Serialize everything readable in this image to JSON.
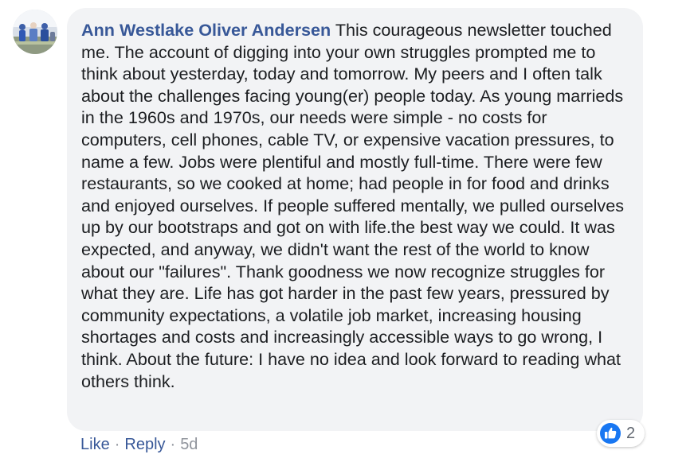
{
  "comment": {
    "author": "Ann Westlake Oliver Andersen",
    "text": "This courageous newsletter touched me. The account of digging into your own struggles prompted me to think about yesterday, today and tomorrow. My peers and I often talk about the challenges facing young(er) people today. As young marrieds in the 1960s and 1970s, our needs were simple - no costs for computers, cell phones, cable TV, or expensive vacation pressures, to name a few. Jobs were plentiful and mostly full-time. There were few restaurants, so we cooked at home; had people in for food and drinks and enjoyed ourselves. If people suffered mentally, we pulled ourselves up by our bootstraps and got on with life.the best way we could. It was expected, and anyway, we didn't want the rest of the world to know about our \"failures\". Thank goodness we now recognize struggles for what they are. Life has got harder in the past few years, pressured by community expectations, a volatile job market, increasing housing shortages and costs and increasingly accessible ways to go wrong, I think. About the future: I have no idea and look forward to reading what others think.",
    "avatar_icon": "profile-photo"
  },
  "actions": {
    "like_label": "Like",
    "separator": "·",
    "reply_label": "Reply",
    "timestamp": "5d"
  },
  "reactions": {
    "icon": "thumbs-up-icon",
    "count": "2",
    "color": "#1877f2"
  },
  "colors": {
    "link": "#385898",
    "bubble": "#f2f3f5",
    "meta": "#90949c"
  }
}
